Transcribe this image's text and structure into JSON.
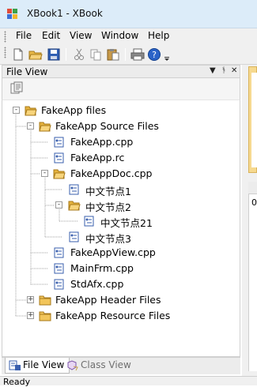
{
  "window": {
    "title": "XBook1 - XBook"
  },
  "menu": [
    "File",
    "Edit",
    "View",
    "Window",
    "Help"
  ],
  "toolbar": {
    "buttons": [
      "new-icon",
      "open-folder-icon",
      "save-icon",
      "cut-icon",
      "copy-icon",
      "paste-icon",
      "print-icon",
      "help-icon"
    ]
  },
  "file_view": {
    "title": "File View",
    "tree": [
      {
        "label": "FakeApp files",
        "icon": "folder-open-icon",
        "expander": "-",
        "level": 0
      },
      {
        "label": "FakeApp Source Files",
        "icon": "folder-open-icon",
        "expander": "-",
        "level": 1
      },
      {
        "label": "FakeApp.cpp",
        "icon": "file-icon",
        "level": 2
      },
      {
        "label": "FakeApp.rc",
        "icon": "file-icon",
        "level": 2
      },
      {
        "label": "FakeAppDoc.cpp",
        "icon": "folder-open-icon",
        "expander": "-",
        "level": 2
      },
      {
        "label": "中文节点1",
        "icon": "file-icon",
        "level": 3
      },
      {
        "label": "中文节点2",
        "icon": "folder-open-icon",
        "expander": "-",
        "level": 3
      },
      {
        "label": "中文节点21",
        "icon": "file-icon",
        "level": 4
      },
      {
        "label": "中文节点3",
        "icon": "file-icon",
        "level": 3
      },
      {
        "label": "FakeAppView.cpp",
        "icon": "file-icon",
        "level": 2
      },
      {
        "label": "MainFrm.cpp",
        "icon": "file-icon",
        "level": 2
      },
      {
        "label": "StdAfx.cpp",
        "icon": "file-icon",
        "level": 2
      },
      {
        "label": "FakeApp Header Files",
        "icon": "folder-icon",
        "expander": "+",
        "level": 1
      },
      {
        "label": "FakeApp Resource Files",
        "icon": "folder-icon",
        "expander": "+",
        "level": 1
      }
    ],
    "tabs": [
      {
        "label": "File View",
        "active": true
      },
      {
        "label": "Class View",
        "active": false
      }
    ]
  },
  "status": {
    "text": "Ready"
  },
  "right_pane": {
    "text": "0"
  }
}
